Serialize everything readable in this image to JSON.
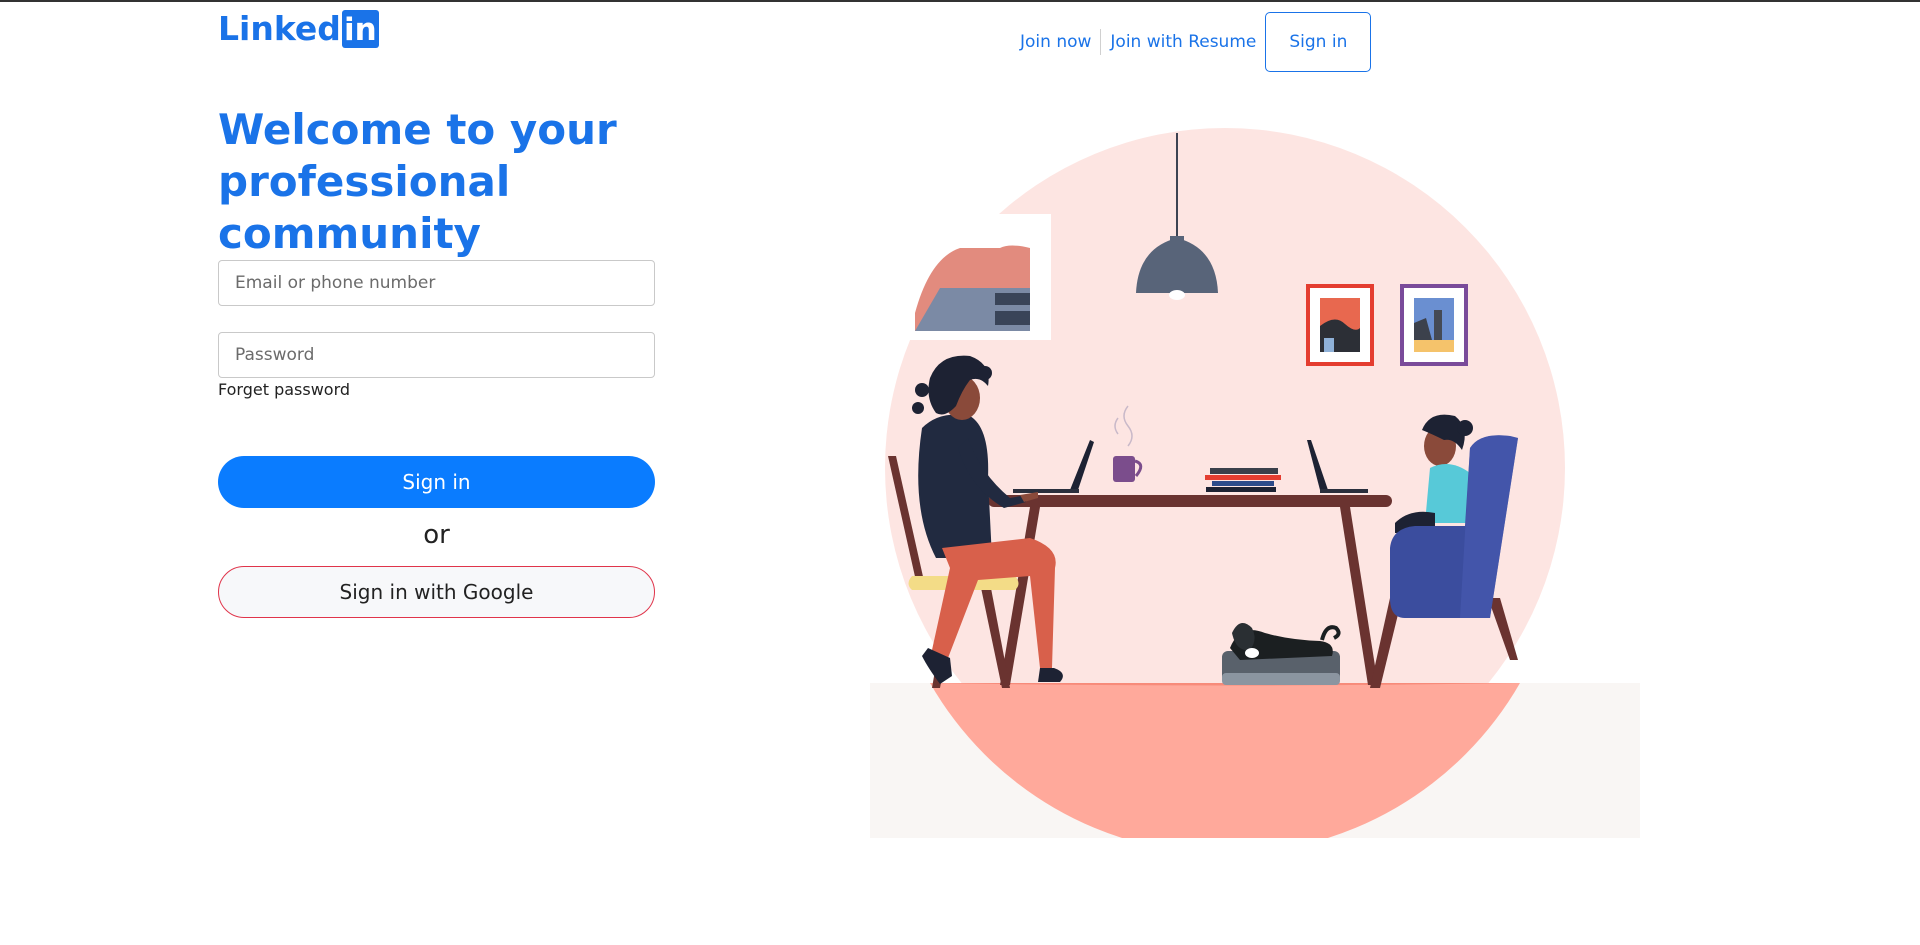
{
  "header": {
    "logo_text": "Linked",
    "logo_box": "in",
    "nav": {
      "join_now": "Join now",
      "join_resume": "Join with Resume",
      "sign_in": "Sign in"
    }
  },
  "main": {
    "headline": "Welcome to your professional community",
    "email_placeholder": "Email or phone number",
    "password_placeholder": "Password",
    "forget_password": "Forget password",
    "sign_in_button": "Sign in",
    "or_text": "or",
    "google_button": "Sign in with Google"
  },
  "colors": {
    "brand": "#1a73e8",
    "primary_button": "#0a7cff",
    "google_border": "#e0344a",
    "circle": "#fde5e2",
    "floor": "#ffa99b"
  },
  "illustration": {
    "subject": "two people working at a table with laptops, a dog on a bed, a pendant lamp and framed pictures",
    "icons": [
      "pendant-lamp-icon",
      "laptop-icon",
      "mug-icon",
      "books-icon",
      "armchair-icon",
      "dog-icon",
      "picture-frame-icon"
    ]
  }
}
